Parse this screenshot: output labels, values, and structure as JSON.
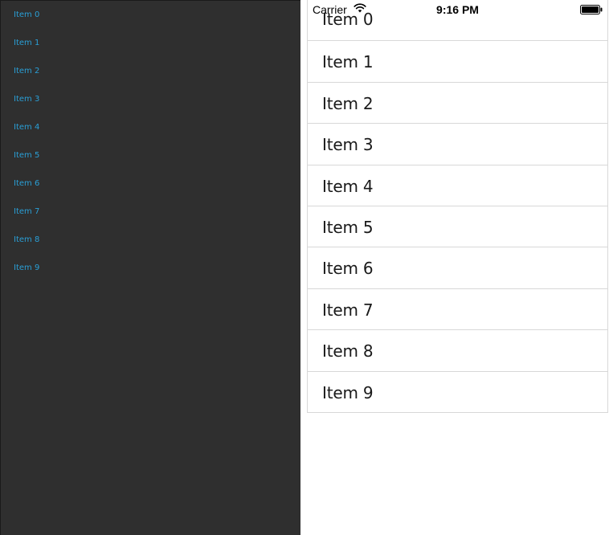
{
  "left_list": {
    "items": [
      "Item 0",
      "Item 1",
      "Item 2",
      "Item 3",
      "Item 4",
      "Item 5",
      "Item 6",
      "Item 7",
      "Item 8",
      "Item 9"
    ]
  },
  "status_bar": {
    "carrier": "Carrier",
    "time": "9:16 PM",
    "wifi_icon": "wifi-icon",
    "battery_icon": "battery-full-icon"
  },
  "table": {
    "rows": [
      "Item 0",
      "Item 1",
      "Item 2",
      "Item 3",
      "Item 4",
      "Item 5",
      "Item 6",
      "Item 7",
      "Item 8",
      "Item 9"
    ]
  },
  "colors": {
    "left_background": "#2f2f2f",
    "left_item_text": "#2a9fd6",
    "separator": "#d8d8d8"
  }
}
